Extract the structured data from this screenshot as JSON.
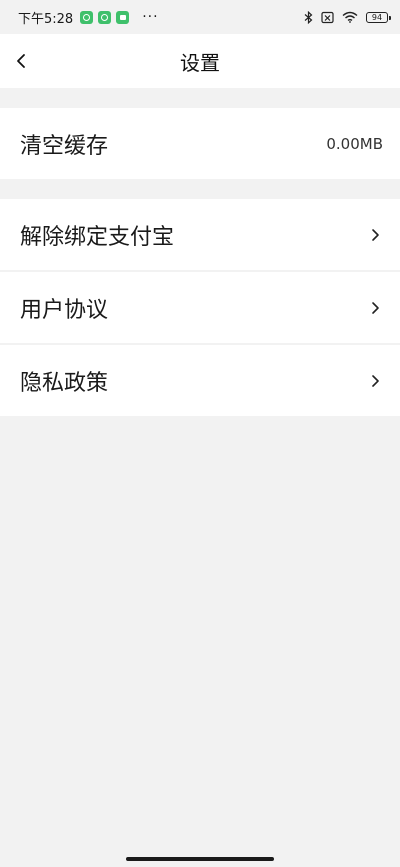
{
  "status_bar": {
    "time": "下午5:28",
    "more": "···",
    "battery": "94",
    "icons": [
      "app-badge-icon",
      "app-badge-icon",
      "app-badge-icon",
      "bluetooth-icon",
      "sim-off-icon",
      "wifi-icon",
      "battery-icon"
    ]
  },
  "nav": {
    "title": "设置",
    "back_icon": "chevron-left-icon"
  },
  "settings": {
    "clear_cache": {
      "label": "清空缓存",
      "value": "0.00MB"
    },
    "items": [
      {
        "label": "解除绑定支付宝",
        "icon": "chevron-right-icon"
      },
      {
        "label": "用户协议",
        "icon": "chevron-right-icon"
      },
      {
        "label": "隐私政策",
        "icon": "chevron-right-icon"
      }
    ]
  },
  "colors": {
    "background": "#f2f2f2",
    "surface": "#ffffff",
    "badge_green": "#3fc06b",
    "text": "#1a1a1a"
  }
}
